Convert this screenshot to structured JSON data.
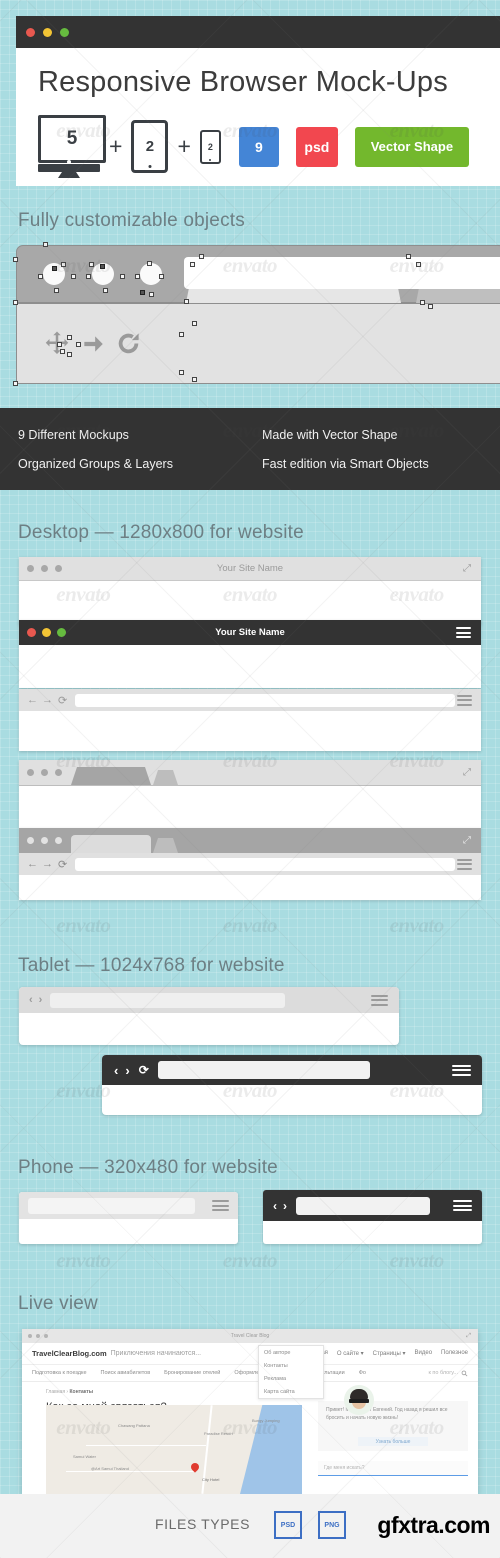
{
  "background_color": "#a9dce1",
  "hero": {
    "title": "Responsive Browser Mock-Ups",
    "window_dots": [
      "red",
      "yellow",
      "green"
    ],
    "counts": {
      "desktop": "5",
      "tablet": "2",
      "phone": "2",
      "plus_1": "+",
      "plus_2": "+"
    },
    "badges": [
      {
        "label": "9",
        "color": "#4485d6"
      },
      {
        "label": "psd",
        "color": "#f2474f"
      },
      {
        "label": "Vector Shape",
        "color": "#73b82d"
      }
    ]
  },
  "sections": {
    "customizable_heading": "Fully customizable objects",
    "desktop_heading": "Desktop — 1280x800 for website",
    "tablet_heading": "Tablet — 1024x768 for website",
    "phone_heading": "Phone — 320x480 for website",
    "live_heading": "Live view"
  },
  "features": [
    "9 Different Mockups",
    "Made with Vector Shape",
    "Organized Groups & Layers",
    "Fast edition via Smart Objects"
  ],
  "mockups": {
    "site_name_light": "Your Site Name",
    "site_name_dark": "Your Site Name",
    "nav_back": "←",
    "nav_forward": "→",
    "nav_reload": "⟳",
    "tablet_back": "‹",
    "tablet_forward": "›",
    "tablet_reload": "⟳",
    "menu_icon": "hamburger-icon",
    "expand_icon": "expand-icon"
  },
  "live_view": {
    "window_title": "Travel Clear Blog",
    "brand": "TravelClearBlog.com",
    "tagline": "Приключения начинаются...",
    "top_nav": [
      "Главная",
      "О сайте ▾",
      "Страницы ▾",
      "Видео",
      "Полезное"
    ],
    "main_nav": [
      "Подготовка к поездке",
      "Поиск авиабилетов",
      "Бронирование отелей",
      "Оформление страховки",
      "Консультации",
      "Фо"
    ],
    "search_placeholder": "к по блогу...",
    "dropdown": [
      "Об авторе",
      "Контакты",
      "Реклама",
      "Карта сайта"
    ],
    "breadcrumb_home": "Главная ›",
    "breadcrumb_current": "Контакты",
    "page_title": "Как со мной связаться?",
    "card_text": "Привет! Меня зовут Евгений. Год назад я решил все бросить и начать новую жизнь!",
    "card_cta": "Узнать больше",
    "form_placeholder": "Где меня искать?",
    "map_labels": [
      "Chawang Pattana",
      "Samui Water",
      "@Art Samui Thailand",
      "Bungy Jumping",
      "Paradise Resort",
      "City Hotel"
    ],
    "map_pin_label": "City Hotel"
  },
  "footer": {
    "files_types_label": "FILES TYPES",
    "file_types": [
      "PSD",
      "PNG"
    ],
    "watermark": "gfxtra.com",
    "accent_color": "#3d6fc4"
  },
  "watermark_text": "envato"
}
